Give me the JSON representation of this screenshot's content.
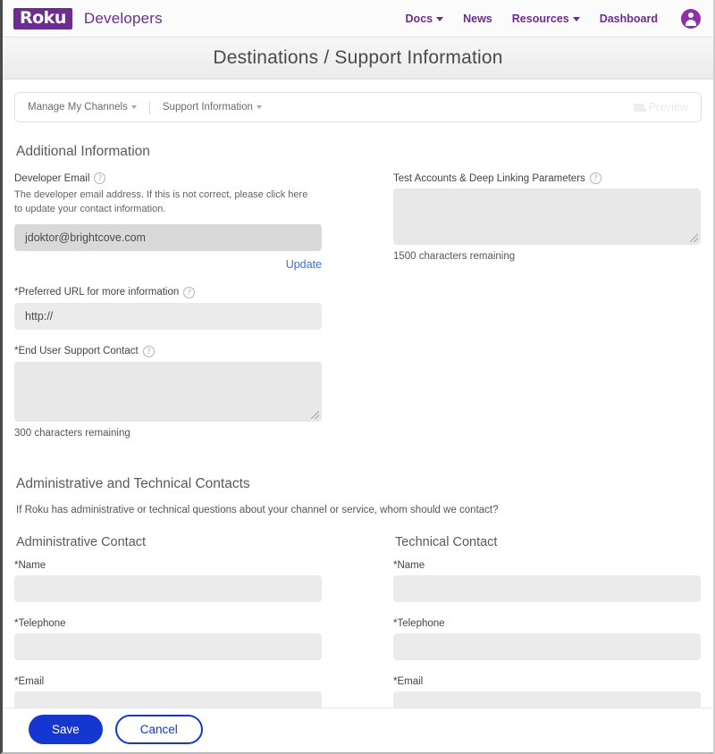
{
  "nav": {
    "logo_text": "Roku",
    "brand_word": "Developers",
    "items": [
      {
        "label": "Docs",
        "has_caret": true
      },
      {
        "label": "News",
        "has_caret": false
      },
      {
        "label": "Resources",
        "has_caret": true
      },
      {
        "label": "Dashboard",
        "has_caret": false
      }
    ],
    "avatar_icon": "user-avatar-icon"
  },
  "header": {
    "title": "Destinations / Support Information"
  },
  "breadcrumb": {
    "items": [
      {
        "label": "Manage My Channels"
      },
      {
        "label": "Support Information"
      }
    ],
    "preview_label": "Preview",
    "preview_icon": "monitor-icon"
  },
  "sections": {
    "additional_information": {
      "heading": "Additional Information",
      "developer_email": {
        "label": "Developer Email",
        "help_icon": "question-mark-icon",
        "description": "The developer email address. If this is not correct, please click here to update your contact information.",
        "value": "jdoktor@brightcove.com",
        "update_link": "Update"
      },
      "preferred_url": {
        "label": "*Preferred URL for more information",
        "help_icon": "question-mark-icon",
        "value": "http://"
      },
      "end_user_support": {
        "label": "*End User Support Contact",
        "help_icon": "question-mark-icon",
        "value": "",
        "char_count": "300 characters remaining"
      },
      "test_accounts": {
        "label": "Test Accounts & Deep Linking Parameters",
        "help_icon": "question-mark-icon",
        "value": "",
        "char_count": "1500 characters remaining"
      }
    },
    "contacts": {
      "heading": "Administrative and Technical Contacts",
      "description": "If Roku has administrative or technical questions about your channel or service, whom should we contact?",
      "administrative": {
        "heading": "Administrative Contact",
        "name_label": "*Name",
        "name_value": "",
        "telephone_label": "*Telephone",
        "telephone_value": "",
        "email_label": "*Email",
        "email_value": ""
      },
      "technical": {
        "heading": "Technical Contact",
        "name_label": "*Name",
        "name_value": "",
        "telephone_label": "*Telephone",
        "telephone_value": "",
        "email_label": "*Email",
        "email_value": ""
      }
    }
  },
  "footer": {
    "save_label": "Save",
    "cancel_label": "Cancel"
  },
  "colors": {
    "brand_purple": "#6c2c90",
    "accent_blue": "#1536cf",
    "link_blue": "#3b6fe0",
    "input_filled": "#d9d9d9",
    "input_empty": "#ebebeb"
  }
}
